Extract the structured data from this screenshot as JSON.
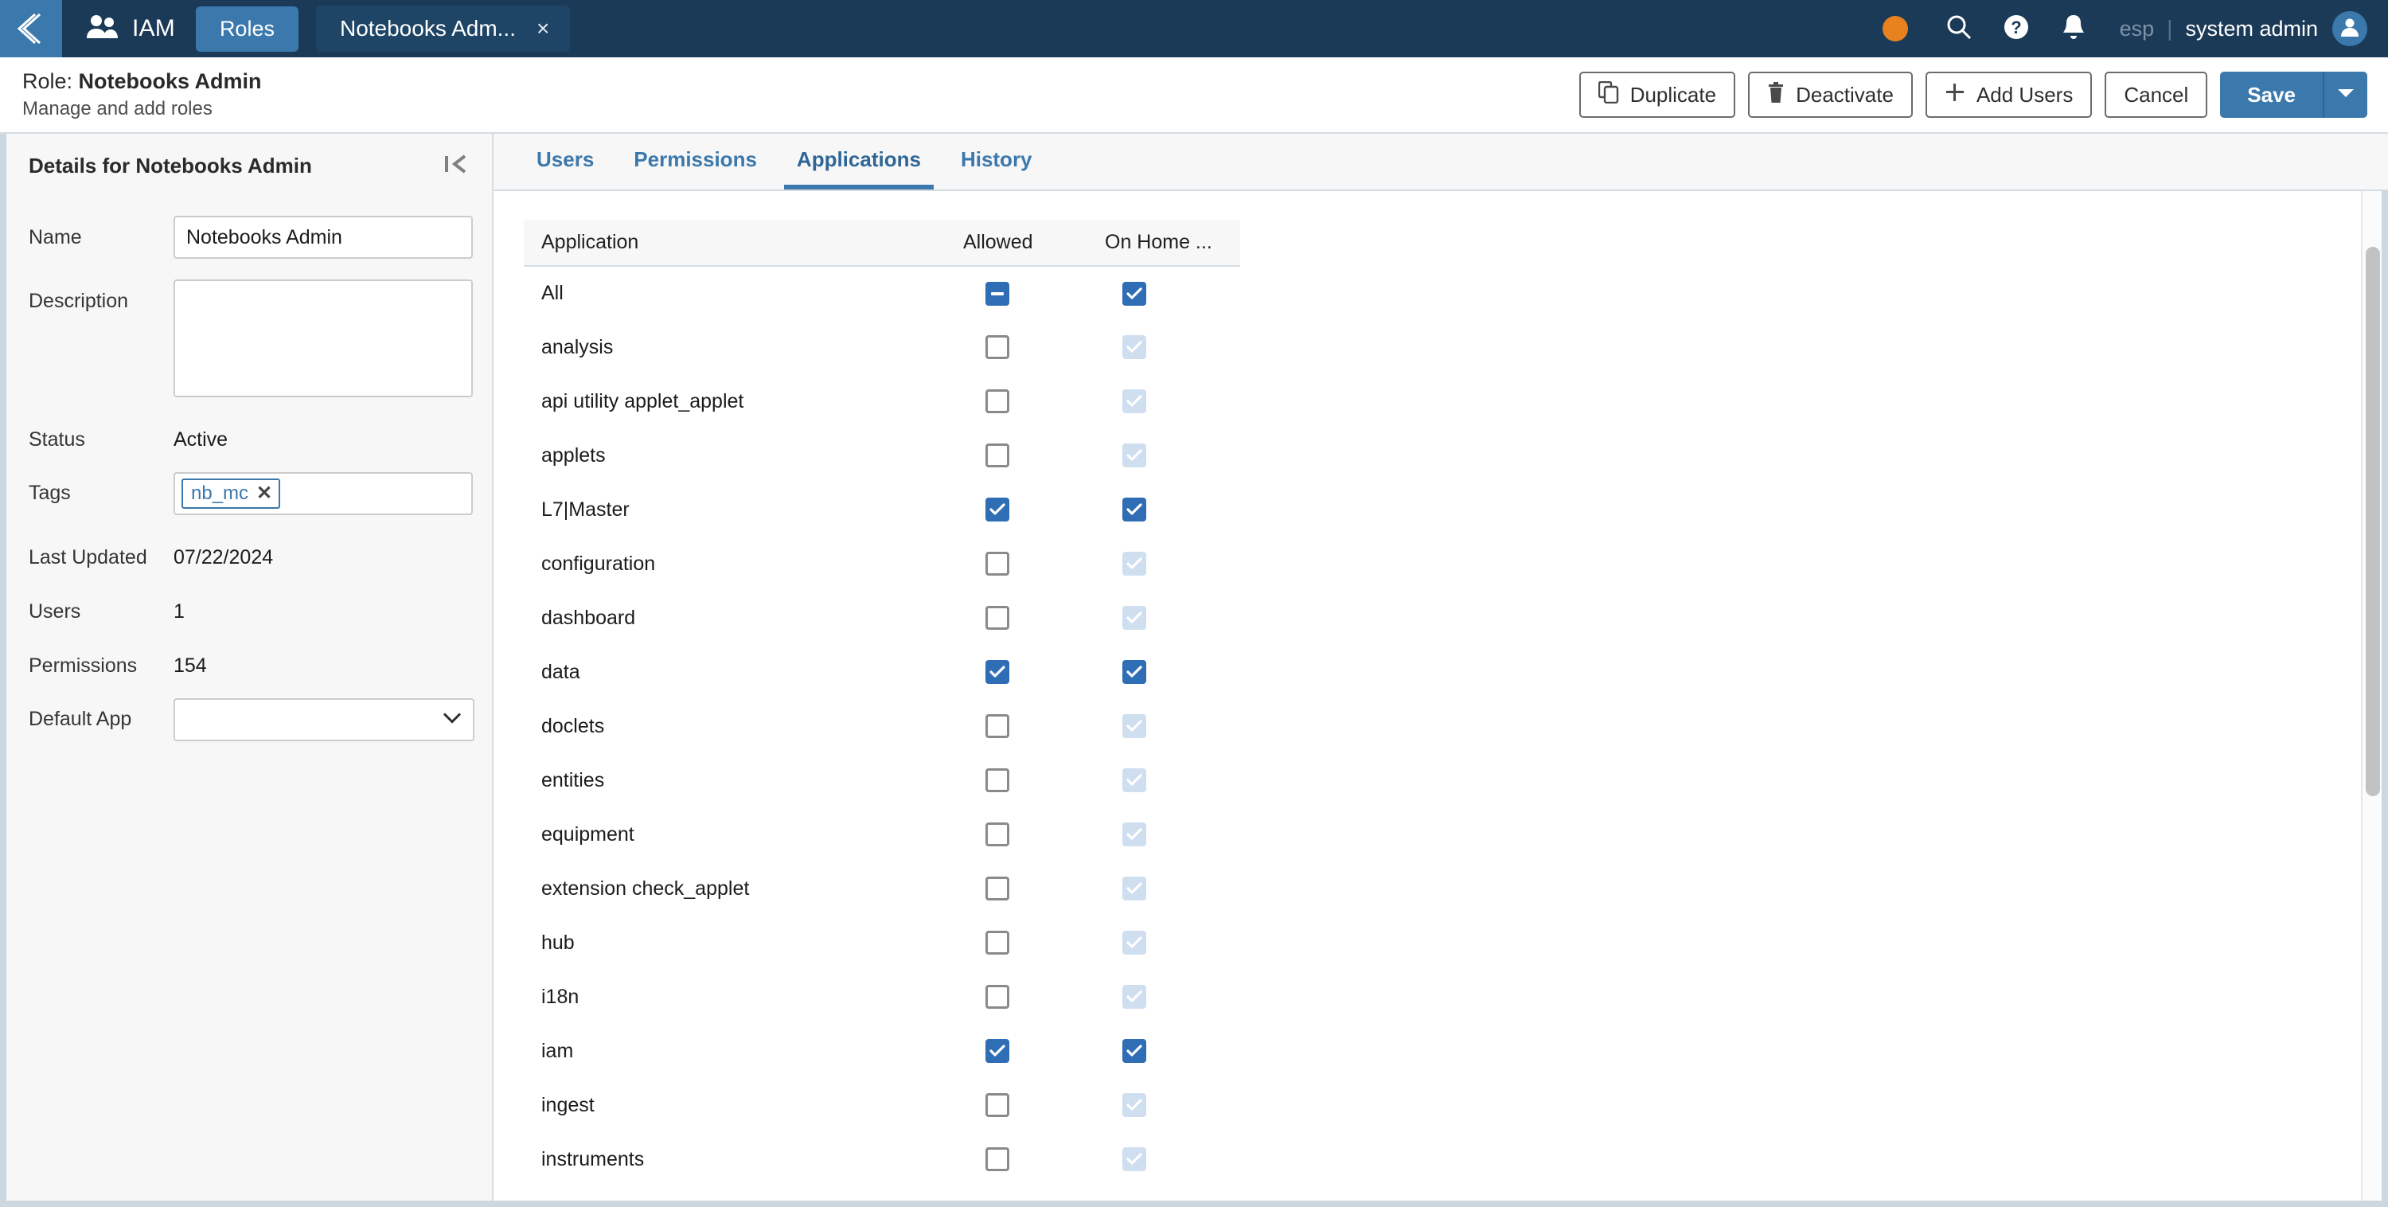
{
  "topnav": {
    "back_icon": "chevron-left-icon",
    "app_icon": "users-icon",
    "app_label": "IAM",
    "pill_label": "Roles",
    "tab_label": "Notebooks Adm...",
    "tab_close": "×",
    "status_dot_color": "#e8821e",
    "search_icon": "search-icon",
    "help_icon": "help-icon",
    "bell_icon": "bell-icon",
    "lang": "esp",
    "separator": "|",
    "user": "system admin",
    "avatar_icon": "user-avatar-icon",
    "background": "#1b3a57",
    "accent": "#3b78ac"
  },
  "pageheader": {
    "title_prefix": "Role: ",
    "title_name": "Notebooks Admin",
    "subtitle": "Manage and add roles",
    "buttons": {
      "duplicate": "Duplicate",
      "deactivate": "Deactivate",
      "add_users": "Add Users",
      "cancel": "Cancel",
      "save": "Save"
    },
    "icons": {
      "duplicate": "copy-icon",
      "deactivate": "trash-icon",
      "add_users": "plus-icon",
      "save_caret": "caret-down-icon"
    }
  },
  "sidebar": {
    "header_title": "Details for Notebooks Admin",
    "collapse_icon": "collapse-panel-icon",
    "fields": {
      "name_label": "Name",
      "name_value": "Notebooks Admin",
      "name_placeholder": "",
      "description_label": "Description",
      "description_value": "",
      "description_placeholder": "",
      "status_label": "Status",
      "status_value": "Active",
      "tags_label": "Tags",
      "tag_value": "nb_mc",
      "tag_remove_icon": "close-icon",
      "last_updated_label": "Last Updated",
      "last_updated_value": "07/22/2024",
      "users_label": "Users",
      "users_value": "1",
      "permissions_label": "Permissions",
      "permissions_value": "154",
      "default_app_label": "Default App",
      "default_app_value": "",
      "default_app_caret": "chevron-down-icon"
    }
  },
  "main": {
    "tabs": [
      {
        "label": "Users",
        "active": false
      },
      {
        "label": "Permissions",
        "active": false
      },
      {
        "label": "Applications",
        "active": true
      },
      {
        "label": "History",
        "active": false
      }
    ],
    "table": {
      "columns": [
        "Application",
        "Allowed",
        "On Home ..."
      ],
      "rows": [
        {
          "application": "All",
          "allowed": "indeterminate",
          "on_home": "checked"
        },
        {
          "application": "analysis",
          "allowed": "unchecked",
          "on_home": "disabled-checked"
        },
        {
          "application": "api utility applet_applet",
          "allowed": "unchecked",
          "on_home": "disabled-checked"
        },
        {
          "application": "applets",
          "allowed": "unchecked",
          "on_home": "disabled-checked"
        },
        {
          "application": "L7|Master",
          "allowed": "checked",
          "on_home": "checked"
        },
        {
          "application": "configuration",
          "allowed": "unchecked",
          "on_home": "disabled-checked"
        },
        {
          "application": "dashboard",
          "allowed": "unchecked",
          "on_home": "disabled-checked"
        },
        {
          "application": "data",
          "allowed": "checked",
          "on_home": "checked"
        },
        {
          "application": "doclets",
          "allowed": "unchecked",
          "on_home": "disabled-checked"
        },
        {
          "application": "entities",
          "allowed": "unchecked",
          "on_home": "disabled-checked"
        },
        {
          "application": "equipment",
          "allowed": "unchecked",
          "on_home": "disabled-checked"
        },
        {
          "application": "extension check_applet",
          "allowed": "unchecked",
          "on_home": "disabled-checked"
        },
        {
          "application": "hub",
          "allowed": "unchecked",
          "on_home": "disabled-checked"
        },
        {
          "application": "i18n",
          "allowed": "unchecked",
          "on_home": "disabled-checked"
        },
        {
          "application": "iam",
          "allowed": "checked",
          "on_home": "checked"
        },
        {
          "application": "ingest",
          "allowed": "unchecked",
          "on_home": "disabled-checked"
        },
        {
          "application": "instruments",
          "allowed": "unchecked",
          "on_home": "disabled-checked"
        }
      ]
    },
    "scrollbar": {
      "name": "vertical-scrollbar"
    }
  },
  "colors": {
    "accent_blue": "#3b78ac",
    "checkbox_blue": "#2f6db5",
    "nav_bg": "#1b3a57",
    "orange_dot": "#e8821e"
  }
}
